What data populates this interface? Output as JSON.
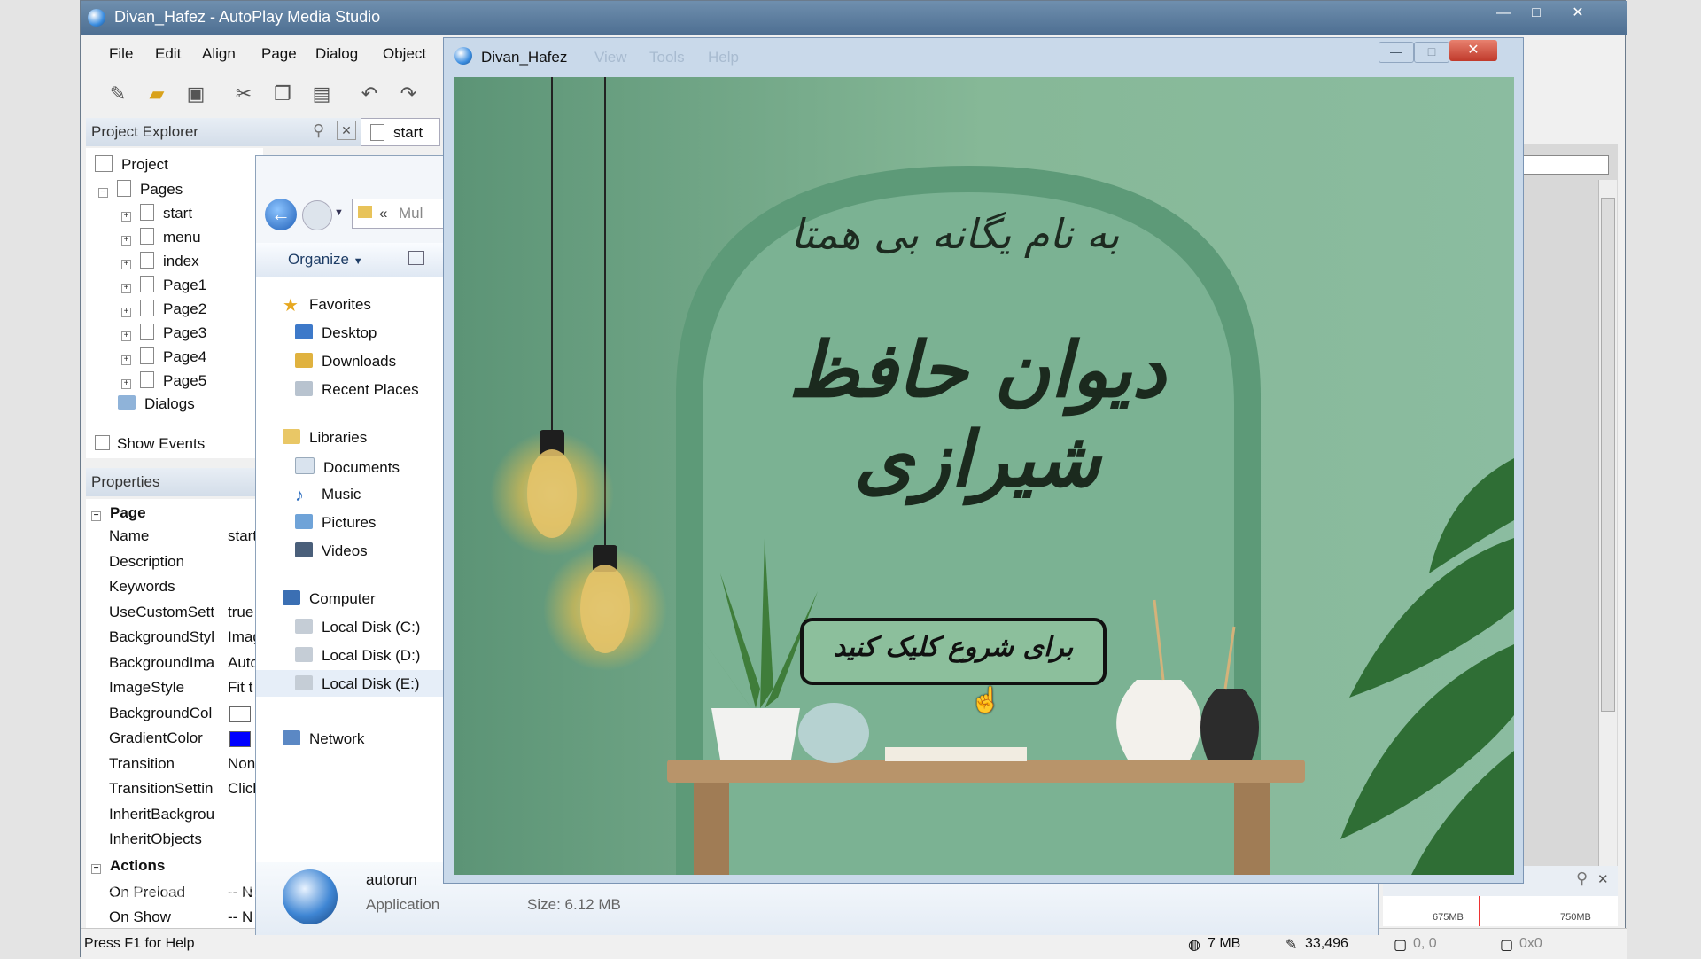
{
  "main_window": {
    "title": "Divan_Hafez - AutoPlay Media Studio",
    "min": "—",
    "max": "□",
    "close": "✕"
  },
  "menu": [
    "File",
    "Edit",
    "Align",
    "Page",
    "Dialog",
    "Object"
  ],
  "project_explorer": {
    "title": "Project Explorer",
    "tab": "start",
    "root": "Project",
    "pages_label": "Pages",
    "pages": [
      "start",
      "menu",
      "index",
      "Page1",
      "Page2",
      "Page3",
      "Page4",
      "Page5"
    ],
    "dialogs_label": "Dialogs",
    "show_events": "Show Events"
  },
  "properties": {
    "title": "Properties",
    "section_page": "Page",
    "rows": [
      {
        "name": "Name",
        "value": "start"
      },
      {
        "name": "Description",
        "value": ""
      },
      {
        "name": "Keywords",
        "value": ""
      },
      {
        "name": "UseCustomSett",
        "value": "true"
      },
      {
        "name": "BackgroundStyl",
        "value": "Imag"
      },
      {
        "name": "BackgroundIma",
        "value": "Auto"
      },
      {
        "name": "ImageStyle",
        "value": "Fit t"
      },
      {
        "name": "BackgroundCol",
        "value": ""
      },
      {
        "name": "GradientColor",
        "value": ""
      },
      {
        "name": "Transition",
        "value": "Non"
      },
      {
        "name": "TransitionSettin",
        "value": "Click"
      },
      {
        "name": "InheritBackgrou",
        "value": ""
      },
      {
        "name": "InheritObjects",
        "value": ""
      }
    ],
    "section_actions": "Actions",
    "actions": [
      {
        "name": "On Preload",
        "value": "-- N"
      },
      {
        "name": "On Show",
        "value": "-- N"
      }
    ],
    "bg_color": "#ffffff",
    "gradient_color": "#0000ff"
  },
  "explorer": {
    "breadcrumb": "Mul",
    "organize": "Organize",
    "favorites": "Favorites",
    "favorite_items": [
      "Desktop",
      "Downloads",
      "Recent Places"
    ],
    "libraries": "Libraries",
    "library_items": [
      "Documents",
      "Music",
      "Pictures",
      "Videos"
    ],
    "computer": "Computer",
    "drives": [
      "Local Disk (C:)",
      "Local Disk (D:)",
      "Local Disk (E:)"
    ],
    "network": "Network",
    "file_name": "autorun",
    "file_type": "Application",
    "file_size": "Size: 6.12 MB"
  },
  "popup": {
    "title": "Divan_Hafez",
    "menu_ghost": [
      "View",
      "Tools",
      "Help"
    ],
    "subtitle": "به نام یگانه بی همتا",
    "heading": "دیوان حافظ شیرازی",
    "start_button": "برای شروع کلیک کنید"
  },
  "ruler": {
    "left_mark": "675MB",
    "right_mark": "750MB"
  },
  "status": {
    "help": "Press F1 for Help",
    "memory": "7 MB",
    "count": "33,496",
    "pos": "0, 0",
    "size": "0x0"
  },
  "watermark": "Developer_ms"
}
